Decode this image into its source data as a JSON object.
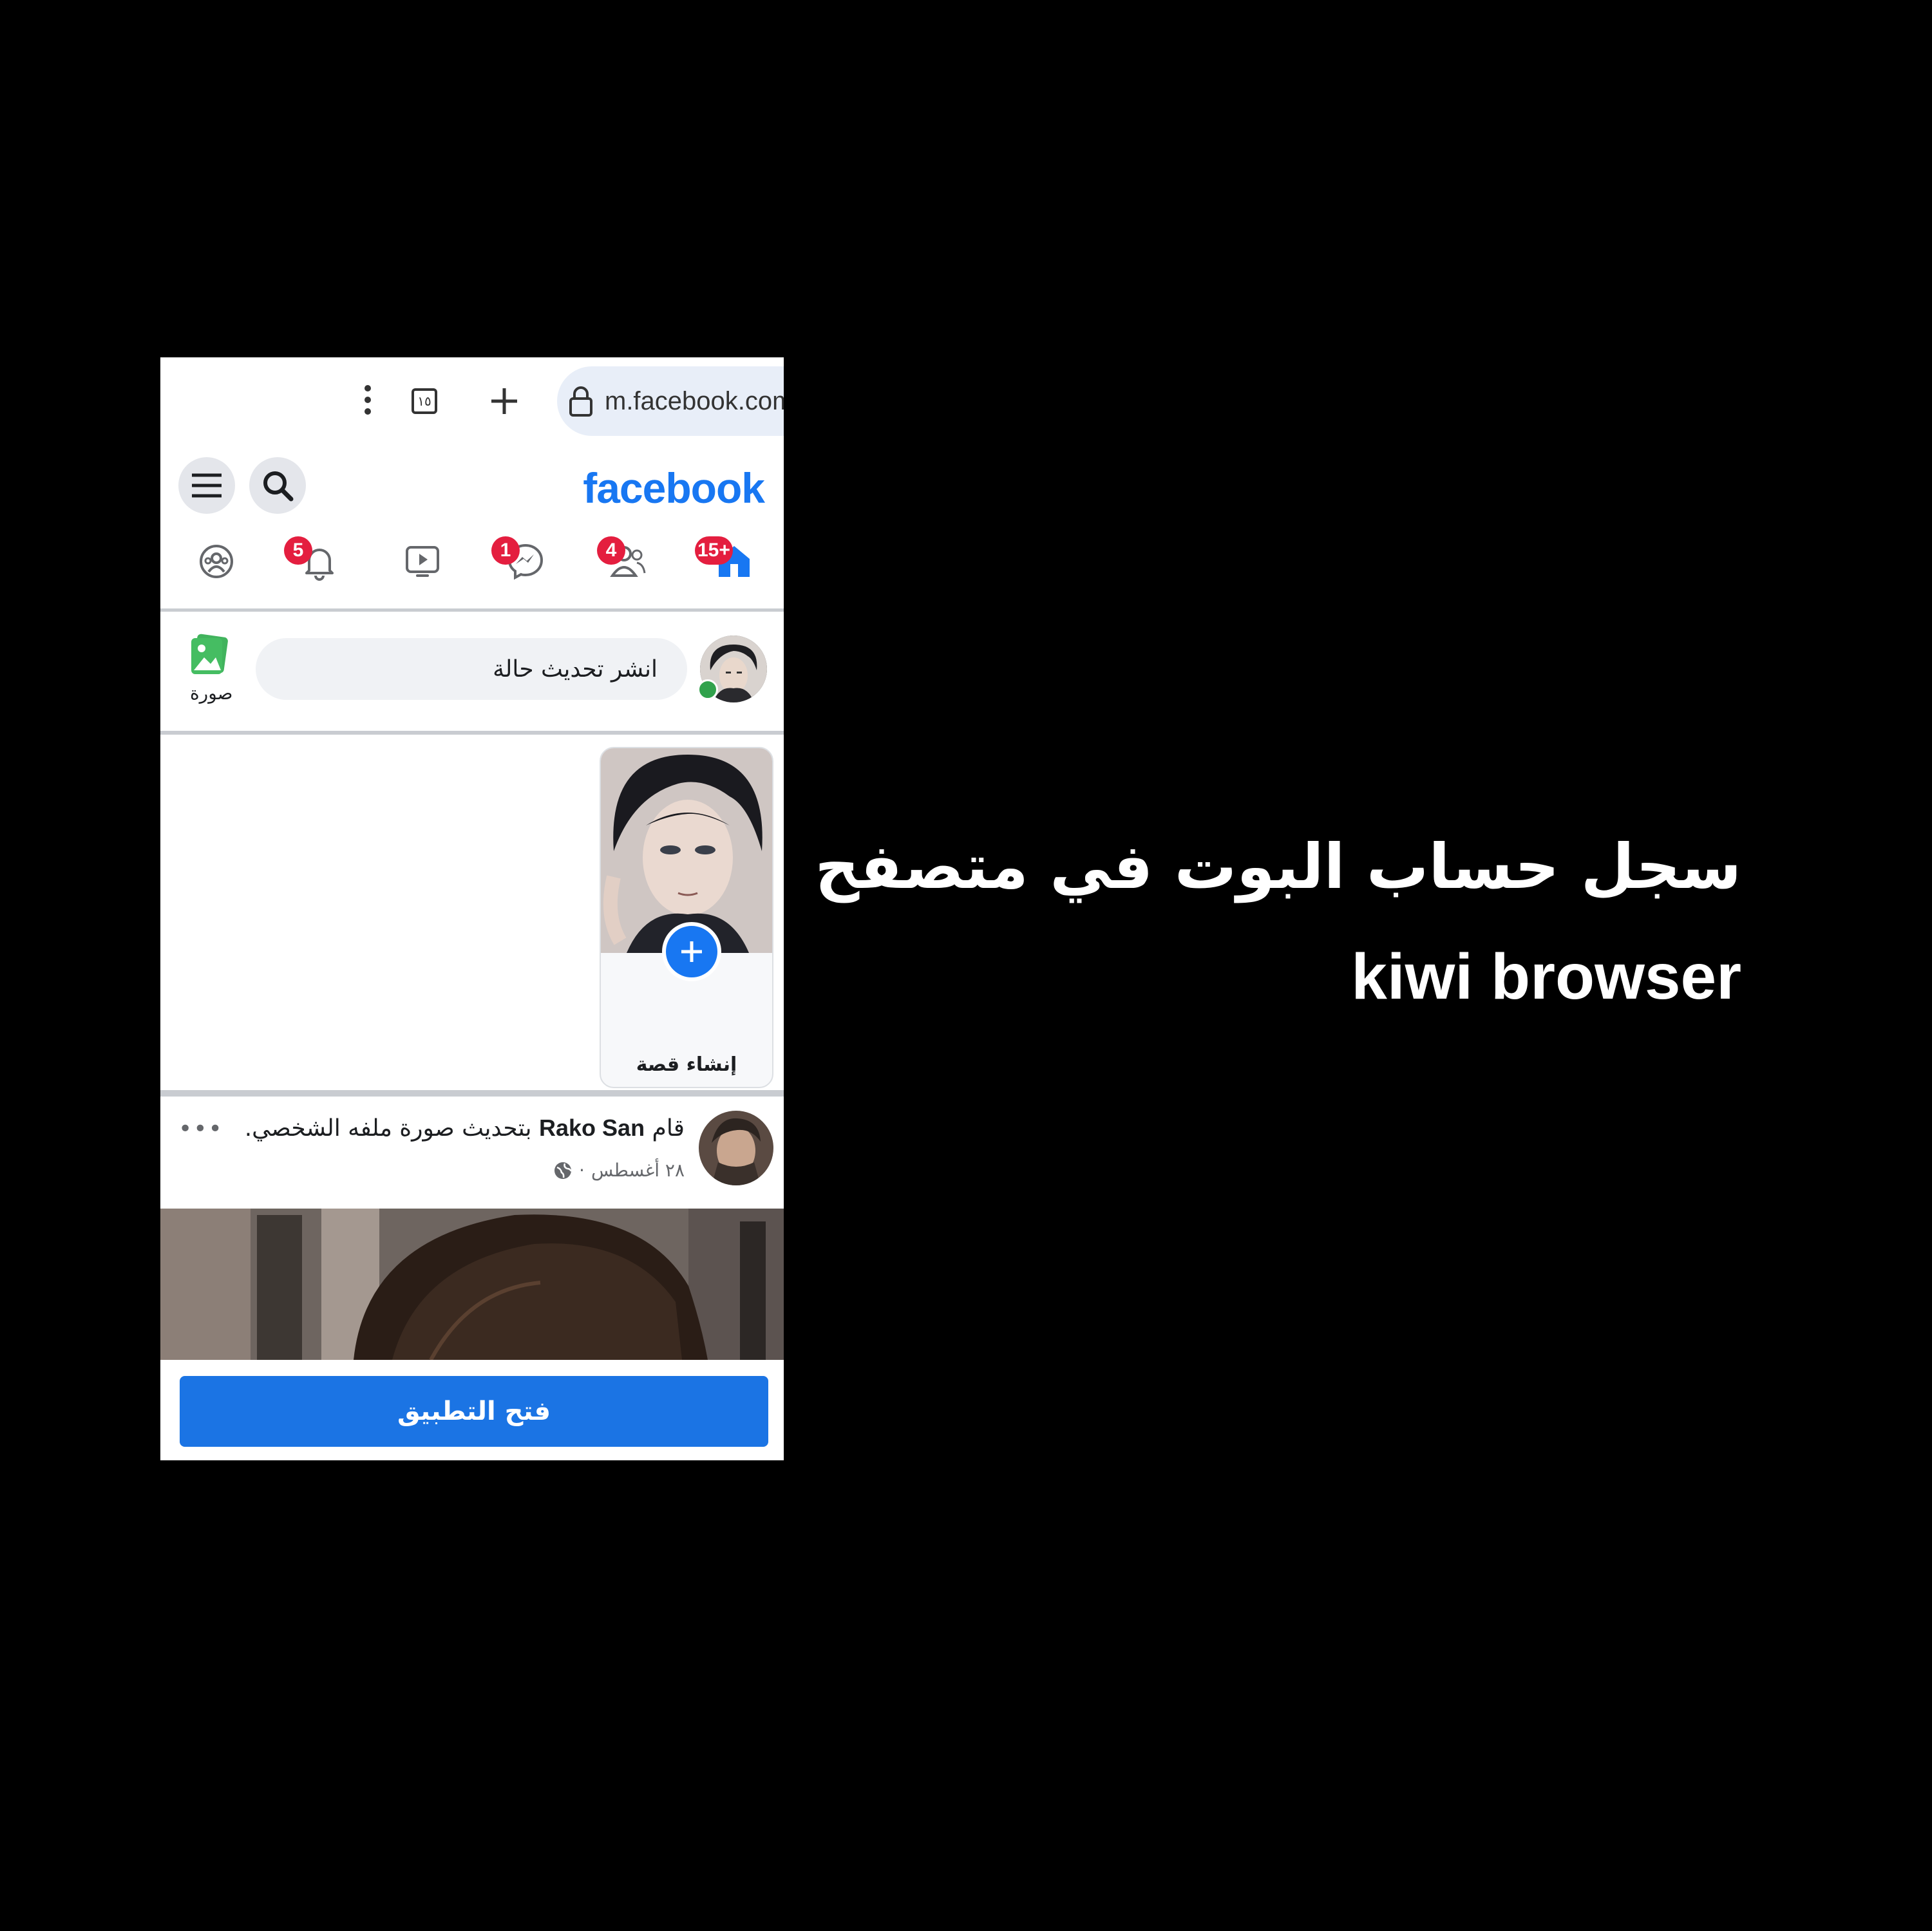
{
  "browser": {
    "url": "m.facebook.com",
    "tab_count": "١٥",
    "icons": [
      "more-vert-icon",
      "tab-switcher-icon",
      "plus-icon",
      "lock-icon",
      "home-icon"
    ]
  },
  "facebook": {
    "logo": "facebook",
    "accent": "#1877f2",
    "badges": {
      "home": "15+",
      "friends": "4",
      "messenger": "1",
      "notifications": "5"
    }
  },
  "composer": {
    "placeholder": "انشر تحديث حالة",
    "photo_label": "صورة"
  },
  "story": {
    "create_label": "إنشاء قصة"
  },
  "post": {
    "prefix": "قام",
    "author": "Rako San",
    "action": "بتحديث صورة ملفه الشخصي.",
    "date": "٢٨ أغسطس",
    "separator": "·"
  },
  "open_app_button": "فتح التطبيق",
  "caption": {
    "line1": "سجل حساب البوت في متصفح",
    "line2": "kiwi browser"
  }
}
